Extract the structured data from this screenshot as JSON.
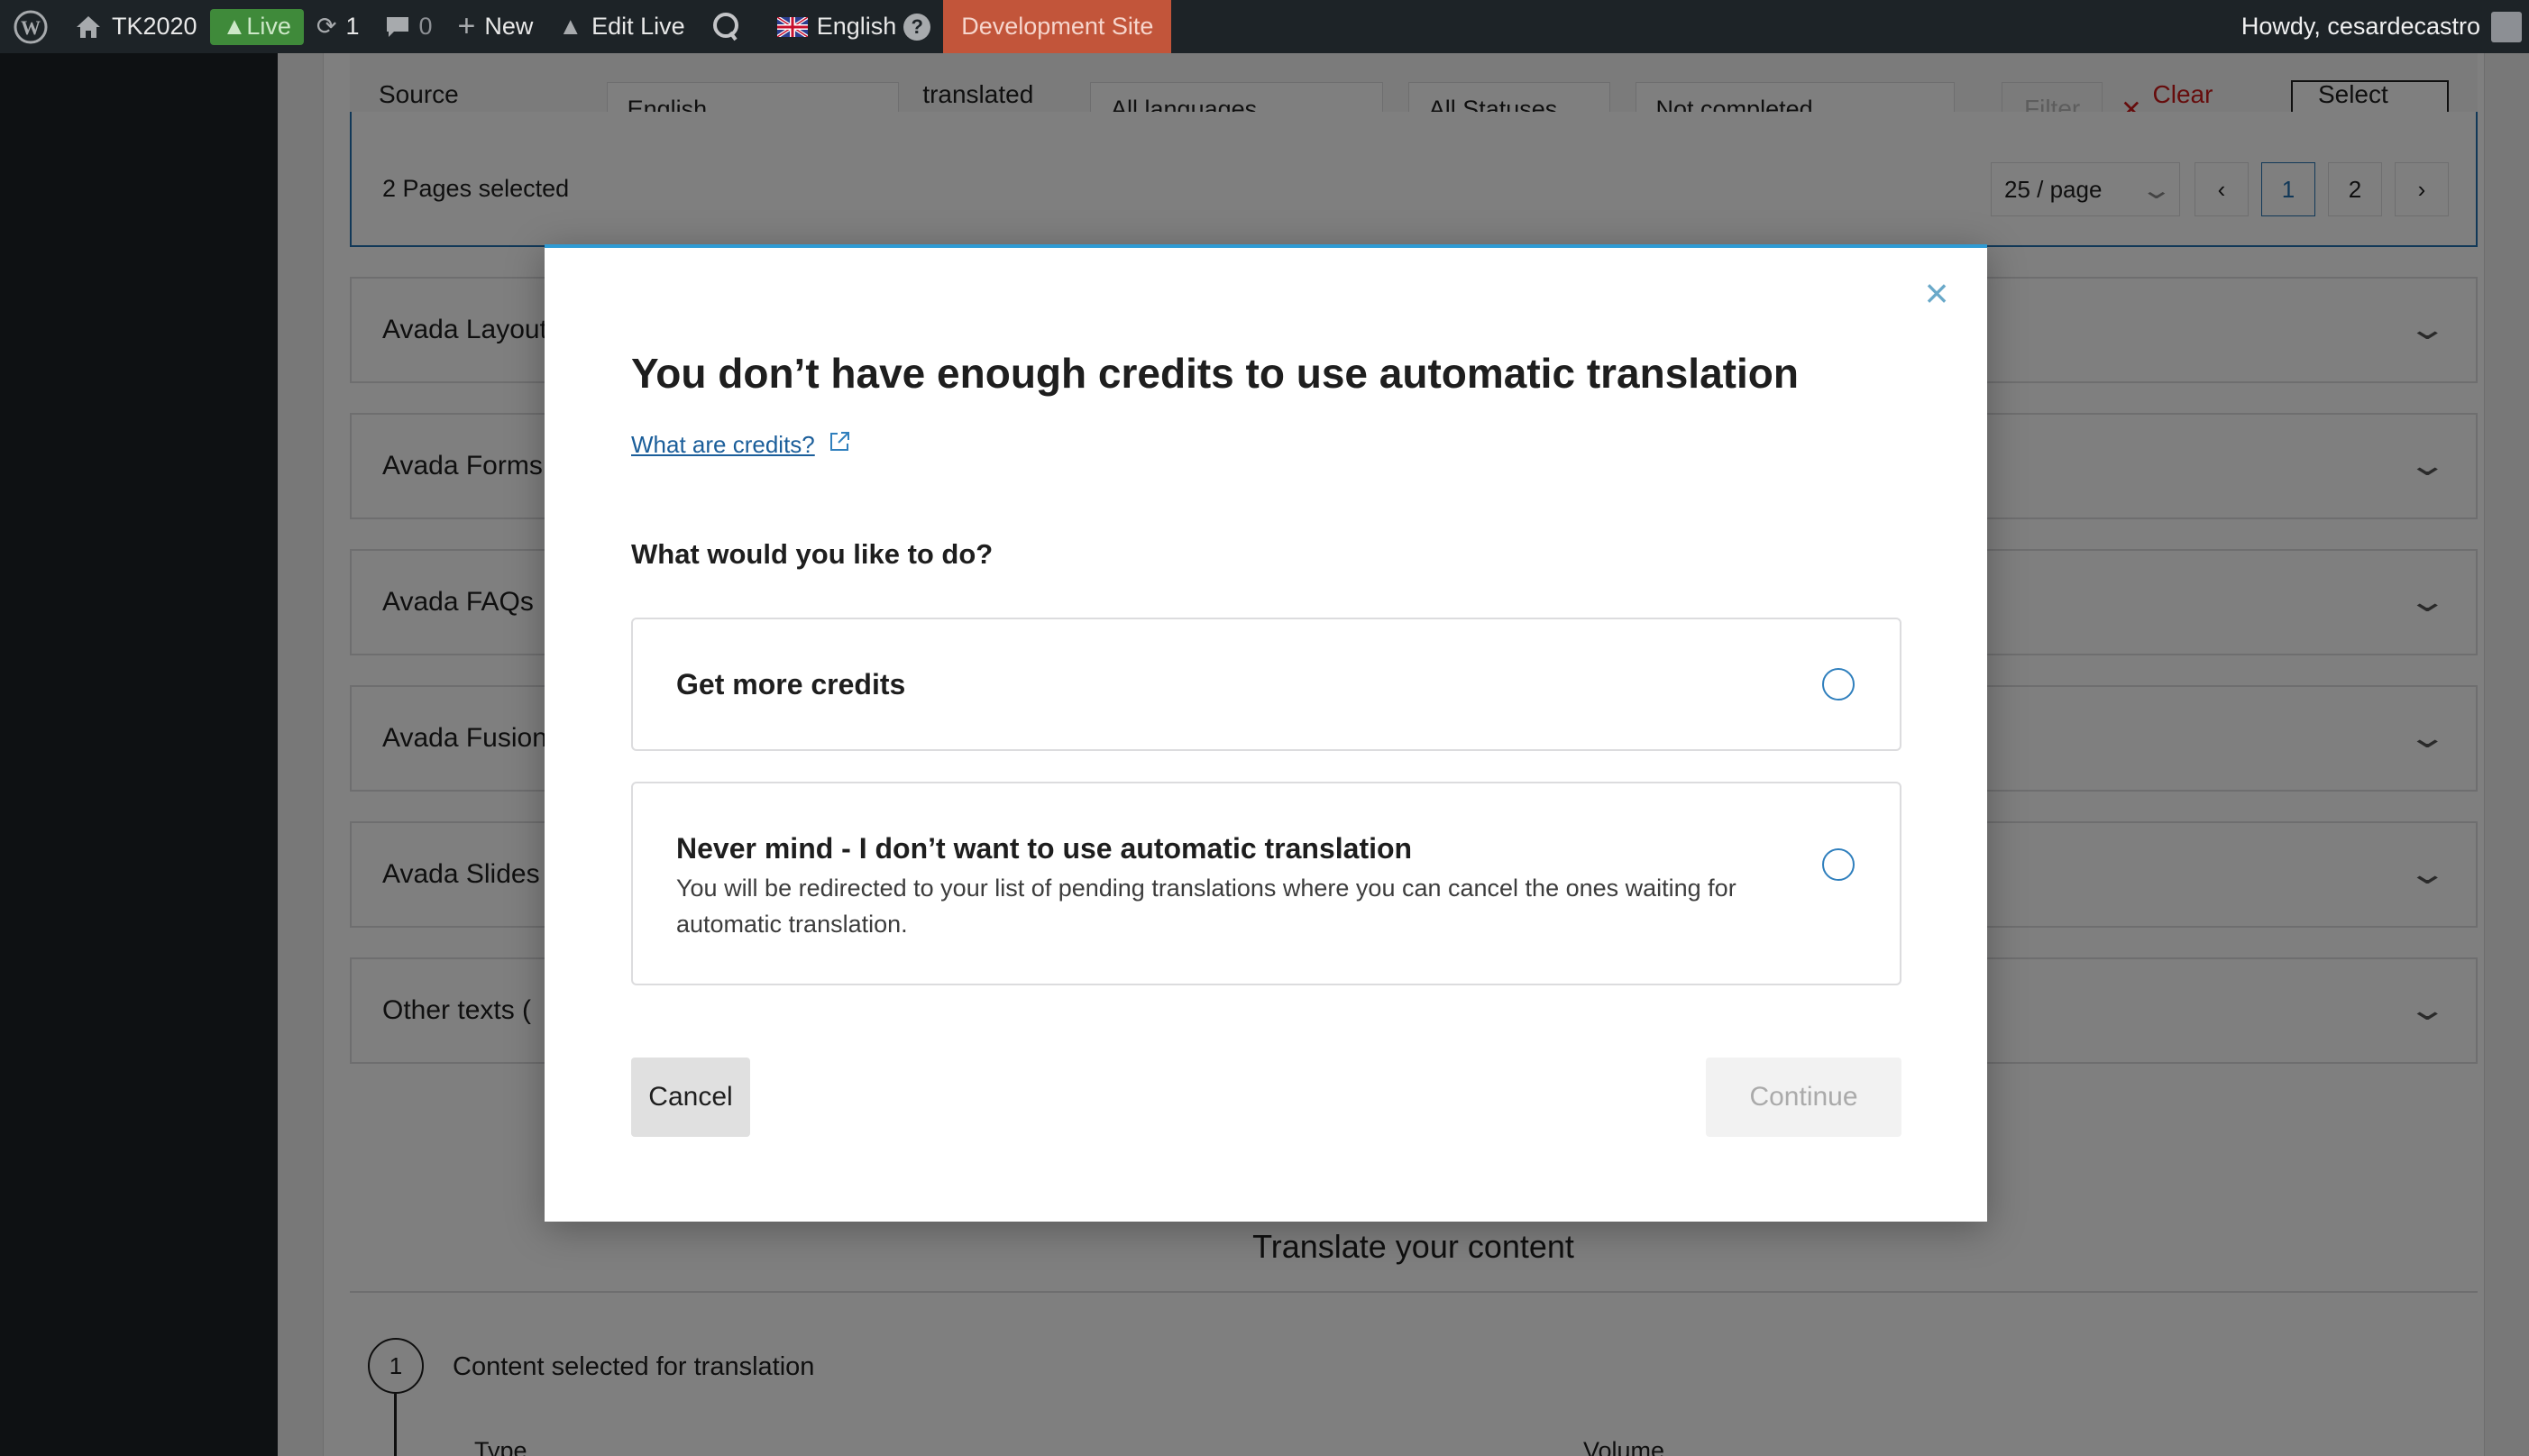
{
  "adminbar": {
    "site_name": "TK2020",
    "live_label": "Live",
    "updates_count": "1",
    "comments_count": "0",
    "new_label": "New",
    "edit_live_label": "Edit Live",
    "language_label": "English",
    "help_label": "?",
    "dev_site_label": "Development Site",
    "greeting": "Howdy, cesardecastro"
  },
  "filters": {
    "source_language_label": "Source Language:",
    "source_language_value": "English",
    "translated_to_label": "translated to:",
    "target_language_value": "All languages",
    "status_value": "All Statuses",
    "completion_value": "Not completed",
    "filter_button": "Filter",
    "clear_filters": "Clear filters",
    "select_all": "Select All"
  },
  "selection": {
    "summary": "2 Pages selected",
    "per_page": "25 / page",
    "pages": [
      "1",
      "2"
    ]
  },
  "sections": [
    "Avada Layout",
    "Avada Forms",
    "Avada FAQs",
    "Avada Fusion",
    "Avada Slides",
    "Other texts ("
  ],
  "translate": {
    "title": "Translate your content",
    "step_number": "1",
    "step_label": "Content selected for translation",
    "col_type": "Type",
    "col_volume": "Volume"
  },
  "modal": {
    "title": "You don’t have enough credits to use automatic translation",
    "link": "What are credits?",
    "question": "What would you like to do?",
    "options": [
      {
        "title": "Get more credits",
        "description": ""
      },
      {
        "title": "Never mind - I don’t want to use automatic translation",
        "description": "You will be redirected to your list of pending translations where you can cancel the ones waiting for automatic translation."
      }
    ],
    "cancel": "Cancel",
    "continue": "Continue"
  }
}
